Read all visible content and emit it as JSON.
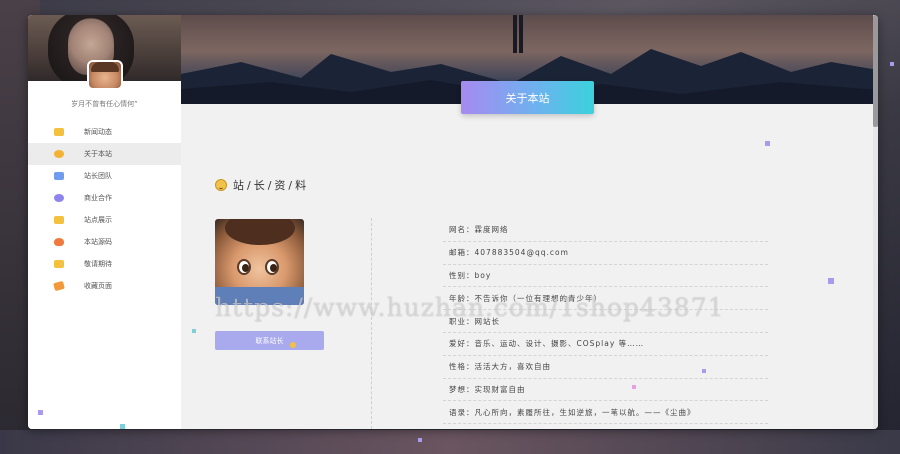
{
  "sidebar": {
    "motto": "岁月不曾有任心情何”",
    "items": [
      {
        "label": "新闻动态",
        "icon": "news-icon",
        "color": "#f4c13c"
      },
      {
        "label": "关于本站",
        "icon": "about-icon",
        "color": "#f3b234"
      },
      {
        "label": "站长团队",
        "icon": "team-icon",
        "color": "#6f9bf0"
      },
      {
        "label": "商业合作",
        "icon": "business-icon",
        "color": "#8d84ef"
      },
      {
        "label": "站点展示",
        "icon": "showcase-icon",
        "color": "#f3c13c"
      },
      {
        "label": "本站源码",
        "icon": "source-icon",
        "color": "#f07a3c"
      },
      {
        "label": "敬请期待",
        "icon": "coming-icon",
        "color": "#f4c13c"
      },
      {
        "label": "收藏页面",
        "icon": "bookmark-icon",
        "color": "#f29a3a"
      }
    ]
  },
  "hero": {
    "button_label": "关于本站"
  },
  "section": {
    "title": "站/长/资/料"
  },
  "profile": {
    "contact_label": "联系站长",
    "info": [
      "网名：霖度网络",
      "邮箱：407883504@qq.com",
      "性别：boy",
      "年龄：不告诉你（一位有理想的青少年）",
      "职业：网站长",
      "爱好：音乐、运动、设计、摄影、COSplay 等……",
      "性格：活活大方，喜欢自由",
      "梦想：实现财富自由",
      "语录：凡心所向，素履所往，生如逆旅，一苇以航。——《尘曲》"
    ]
  },
  "watermark": "https://www.huzhan.com/1shop43871"
}
